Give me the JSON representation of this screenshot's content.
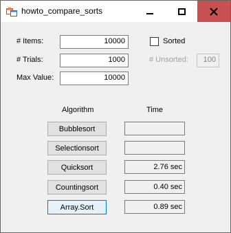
{
  "window": {
    "title": "howto_compare_sorts",
    "close_color": "#c75050"
  },
  "titlebar": {
    "icon": "app-window-icon",
    "minimize_icon": "minimize-icon",
    "maximize_icon": "maximize-icon",
    "close_icon": "close-icon"
  },
  "settings": {
    "items_label": "# Items:",
    "items_value": "10000",
    "trials_label": "# Trials:",
    "trials_value": "1000",
    "max_value_label": "Max Value:",
    "max_value_value": "10000",
    "sorted_label": "Sorted",
    "sorted_checked": false,
    "unsorted_label": "# Unsorted:",
    "unsorted_value": "100"
  },
  "results": {
    "algorithm_header": "Algorithm",
    "time_header": "Time",
    "rows": [
      {
        "label": "Bubblesort",
        "time": ""
      },
      {
        "label": "Selectionsort",
        "time": ""
      },
      {
        "label": "Quicksort",
        "time": "2.76 sec"
      },
      {
        "label": "Countingsort",
        "time": "0.40 sec"
      },
      {
        "label": "Array.Sort",
        "time": "0.89 sec"
      }
    ]
  }
}
